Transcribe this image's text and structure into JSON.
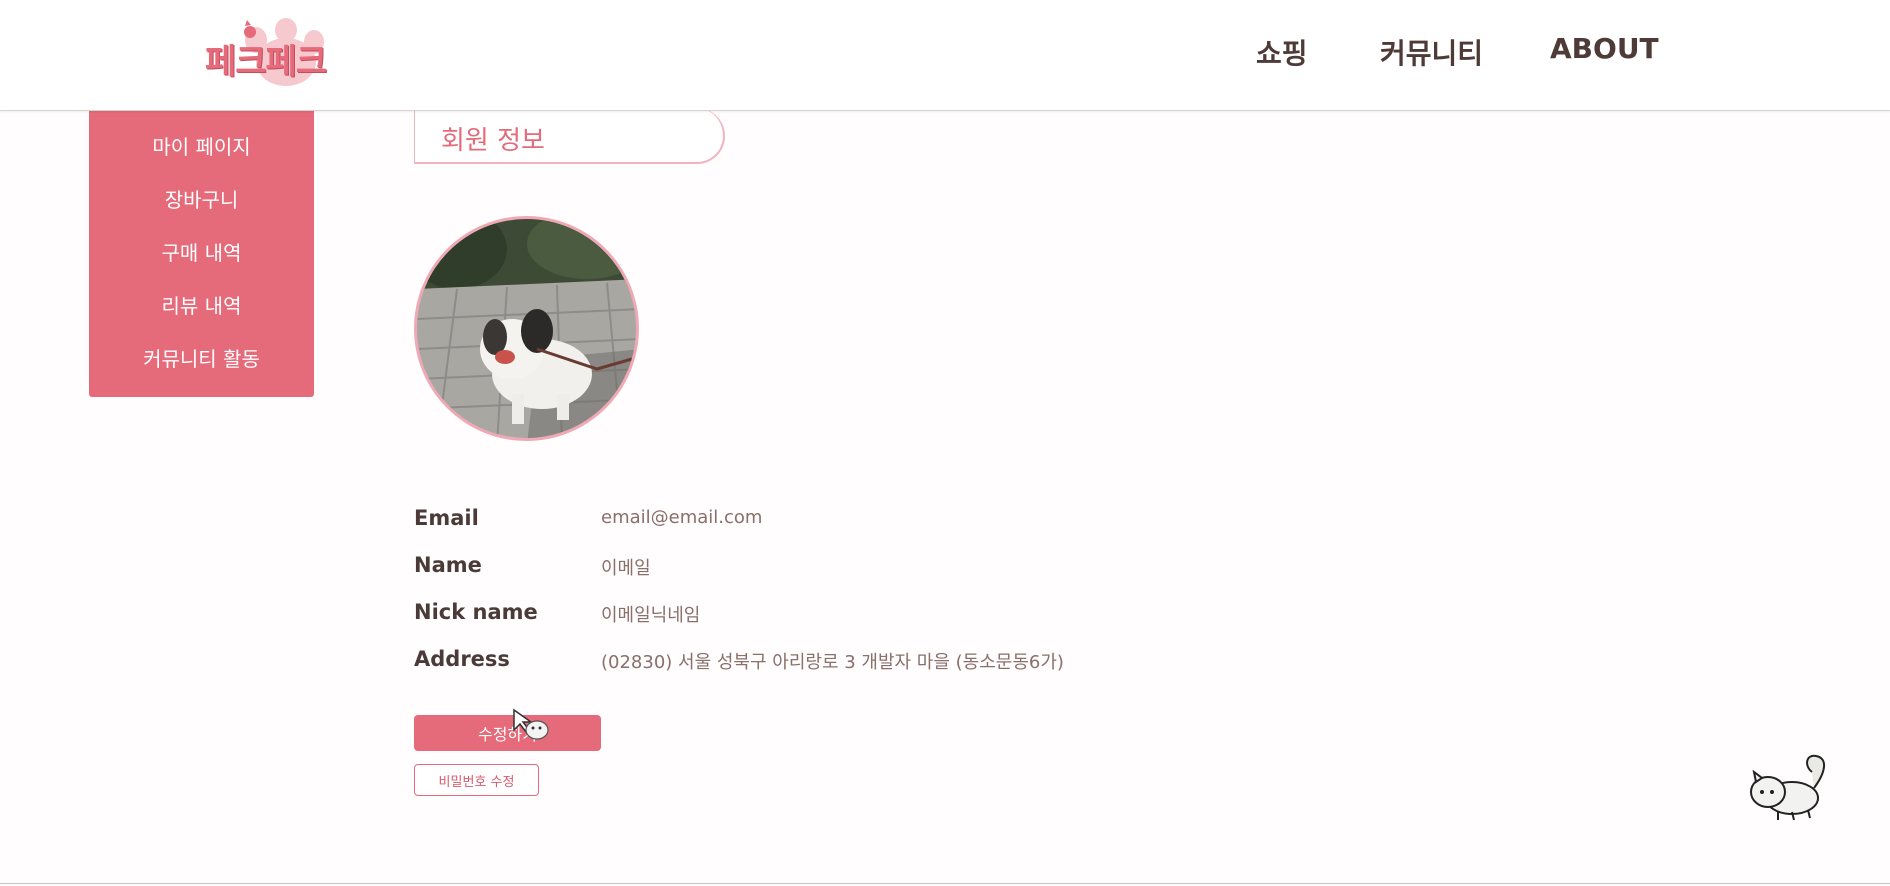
{
  "header": {
    "logo_text": "페크페크",
    "nav": [
      "쇼핑",
      "커뮤니티",
      "ABOUT"
    ]
  },
  "sidebar": {
    "items": [
      "마이 페이지",
      "장바구니",
      "구매 내역",
      "리뷰 내역",
      "커뮤니티 활동"
    ]
  },
  "section": {
    "title": "회원 정보"
  },
  "profile": {
    "fields": [
      {
        "label": "Email",
        "value": "email@email.com"
      },
      {
        "label": "Name",
        "value": "이메일"
      },
      {
        "label": "Nick name",
        "value": "이메일닉네임"
      },
      {
        "label": "Address",
        "value": "(02830) 서울 성북구 아리랑로 3 개발자 마을 (동소문동6가)"
      }
    ]
  },
  "buttons": {
    "edit": "수정하기",
    "change_password": "비밀번호 수정"
  },
  "colors": {
    "accent": "#e56a7a",
    "text": "#4a3b38",
    "muted": "#8a6f6a"
  },
  "icons": {
    "logo": "paw-logo-icon",
    "avatar": "dog-photo",
    "cursor": "pet-cursor-icon",
    "floating": "pet-mascot-icon"
  }
}
